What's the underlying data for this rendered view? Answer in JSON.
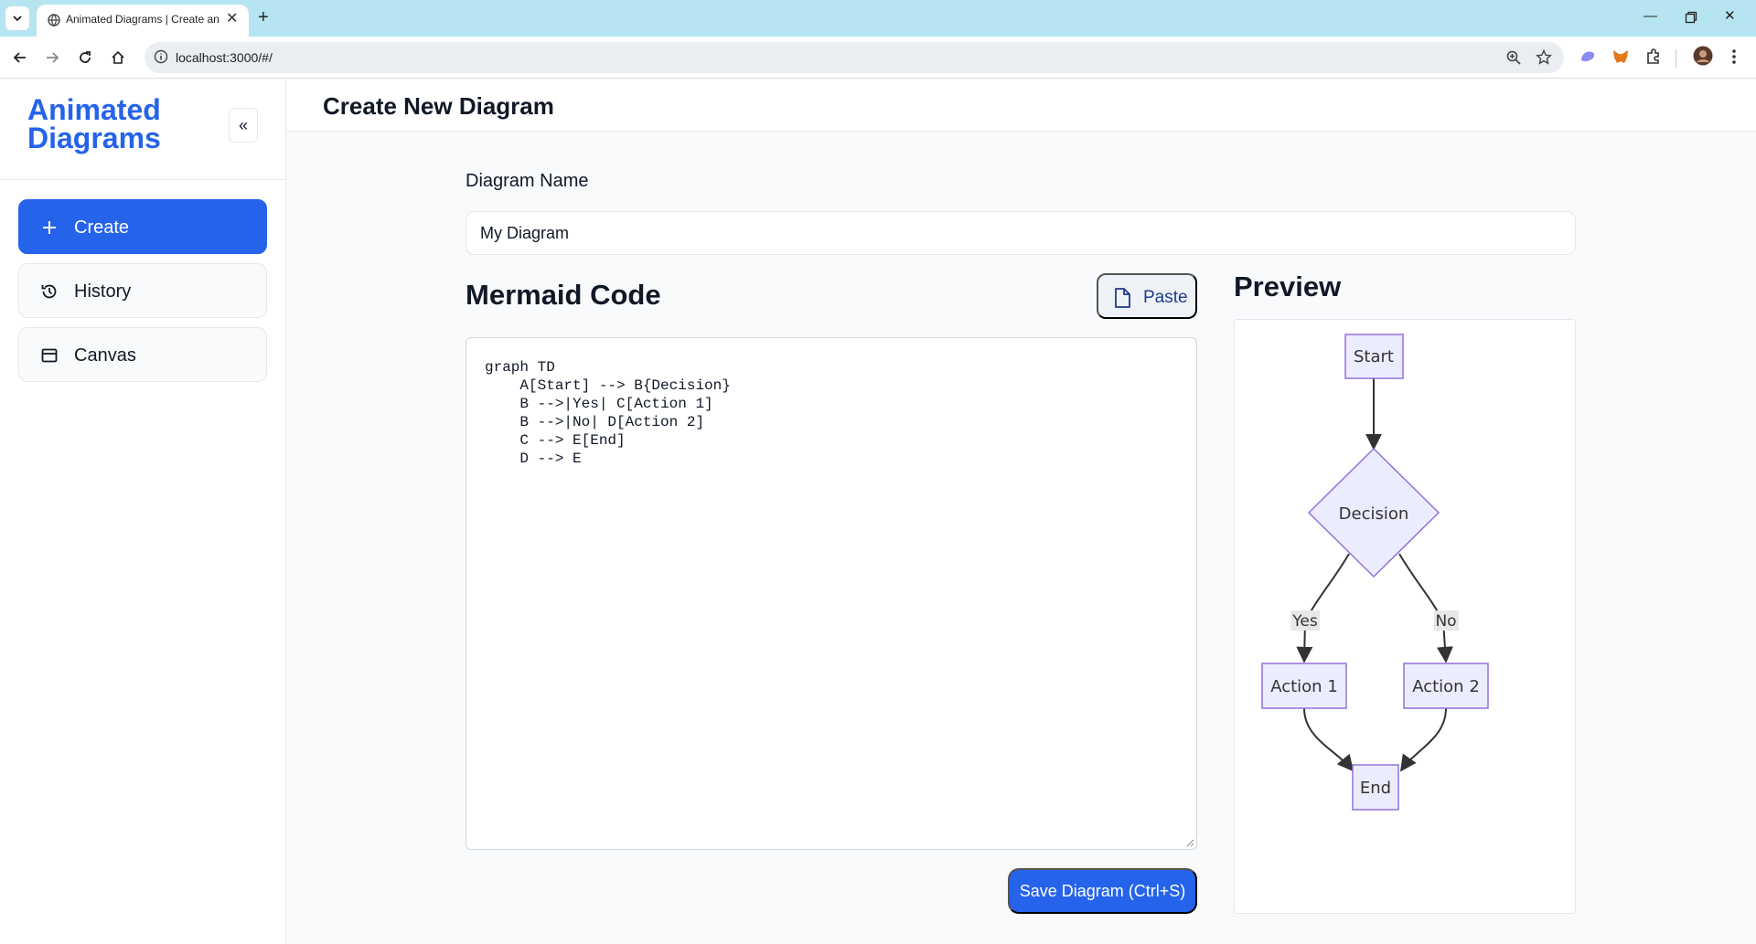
{
  "browser": {
    "tab_title": "Animated Diagrams | Create an",
    "url": "localhost:3000/#/"
  },
  "sidebar": {
    "brand": "Animated Diagrams",
    "collapse_label": "«",
    "items": [
      {
        "label": "Create",
        "icon": "plus-icon",
        "active": true
      },
      {
        "label": "History",
        "icon": "history-icon",
        "active": false
      },
      {
        "label": "Canvas",
        "icon": "canvas-icon",
        "active": false
      }
    ]
  },
  "header": {
    "title": "Create New Diagram"
  },
  "form": {
    "name_label": "Diagram Name",
    "name_value": "My Diagram",
    "code_heading": "Mermaid Code",
    "paste_label": "Paste",
    "code_value": "graph TD\n    A[Start] --> B{Decision}\n    B -->|Yes| C[Action 1]\n    B -->|No| D[Action 2]\n    C --> E[End]\n    D --> E",
    "save_label": "Save Diagram (Ctrl+S)"
  },
  "preview": {
    "heading": "Preview",
    "nodes": {
      "start": "Start",
      "decision": "Decision",
      "action1": "Action 1",
      "action2": "Action 2",
      "end": "End"
    },
    "edge_labels": {
      "yes": "Yes",
      "no": "No"
    }
  },
  "colors": {
    "accent": "#2563eb",
    "node_fill": "#ececff",
    "node_stroke": "#9370db",
    "edge": "#333333"
  }
}
